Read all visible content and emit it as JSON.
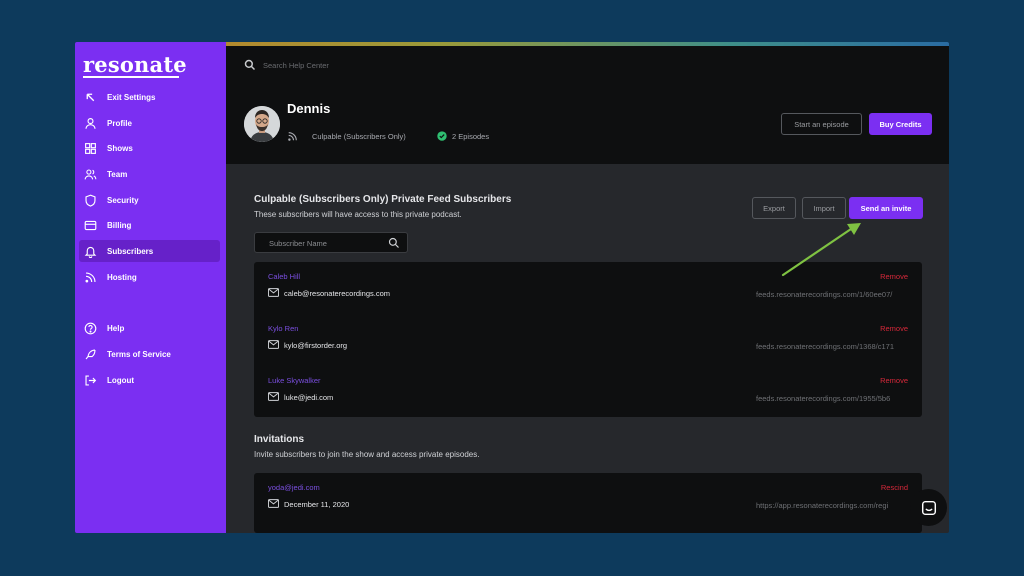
{
  "sidebar": {
    "logo": "resonate",
    "items": [
      {
        "label": "Exit Settings",
        "icon": "arrow-up-left-icon"
      },
      {
        "label": "Profile",
        "icon": "user-icon"
      },
      {
        "label": "Shows",
        "icon": "grid-icon"
      },
      {
        "label": "Team",
        "icon": "team-icon"
      },
      {
        "label": "Security",
        "icon": "shield-icon"
      },
      {
        "label": "Billing",
        "icon": "credit-card-icon"
      },
      {
        "label": "Subscribers",
        "icon": "bell-icon",
        "active": true
      },
      {
        "label": "Hosting",
        "icon": "rss-icon"
      }
    ],
    "bottom_items": [
      {
        "label": "Help",
        "icon": "help-circle-icon"
      },
      {
        "label": "Terms of Service",
        "icon": "feather-icon"
      },
      {
        "label": "Logout",
        "icon": "logout-icon"
      }
    ]
  },
  "header": {
    "search_placeholder": "Search Help Center",
    "user_name": "Dennis",
    "show_name": "Culpable (Subscribers Only)",
    "episodes": "2 Episodes",
    "start_episode_label": "Start an episode",
    "buy_credits_label": "Buy Credits"
  },
  "subscribers": {
    "title": "Culpable (Subscribers Only) Private Feed Subscribers",
    "subtitle": "These subscribers will have access to this private podcast.",
    "export_label": "Export",
    "import_label": "Import",
    "invite_label": "Send an invite",
    "search_placeholder": "Subscriber Name",
    "rows": [
      {
        "name": "Caleb Hill",
        "email": "caleb@resonaterecordings.com",
        "remove": "Remove",
        "url": "feeds.resonaterecordings.com/1/60ee07/"
      },
      {
        "name": "Kylo Ren",
        "email": "kylo@firstorder.org",
        "remove": "Remove",
        "url": "feeds.resonaterecordings.com/1368/c171"
      },
      {
        "name": "Luke Skywalker",
        "email": "luke@jedi.com",
        "remove": "Remove",
        "url": "feeds.resonaterecordings.com/1955/5b6"
      }
    ]
  },
  "invitations": {
    "title": "Invitations",
    "subtitle": "Invite subscribers to join the show and access private episodes.",
    "rows": [
      {
        "name": "yoda@jedi.com",
        "date": "December 11, 2020",
        "remove": "Rescind",
        "url": "https://app.resonaterecordings.com/regi"
      }
    ]
  },
  "colors": {
    "brand_purple": "#7b2ff2",
    "remove_red": "#d6283a",
    "annotation_green": "#7fc242",
    "background": "#0d3a5c"
  }
}
